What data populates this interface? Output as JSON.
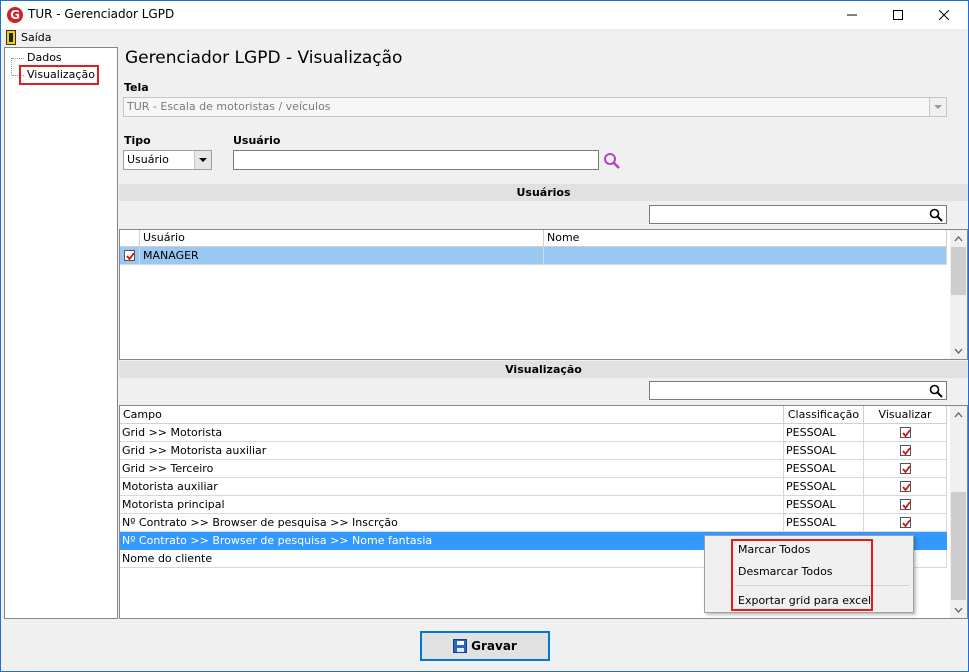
{
  "window": {
    "title": "TUR - Gerenciador LGPD",
    "icon": "app-logo-icon",
    "controls": [
      "minimize-icon",
      "maximize-icon",
      "close-icon"
    ]
  },
  "menu": {
    "exit_label": "Saída"
  },
  "tree": {
    "items": [
      {
        "label": "Dados"
      },
      {
        "label": "Visualização",
        "selected": true
      }
    ]
  },
  "main": {
    "heading": "Gerenciador LGPD - Visualização",
    "tela_label": "Tela",
    "tela_value": "TUR - Escala de motoristas / veículos",
    "tipo_label": "Tipo",
    "tipo_value": "Usuário",
    "usuario_label": "Usuário",
    "usuario_value": ""
  },
  "users_section": {
    "title": "Usuários",
    "search_value": "",
    "columns": [
      "Usuário",
      "Nome"
    ],
    "rows": [
      {
        "checked": true,
        "usuario": "MANAGER",
        "nome": ""
      }
    ]
  },
  "view_section": {
    "title": "Visualização",
    "search_value": "",
    "columns": [
      "Campo",
      "Classificação",
      "Visualizar"
    ],
    "rows": [
      {
        "campo": "Grid >> Motorista",
        "classificacao": "PESSOAL",
        "visualizar": true
      },
      {
        "campo": "Grid >> Motorista auxiliar",
        "classificacao": "PESSOAL",
        "visualizar": true
      },
      {
        "campo": "Grid >> Terceiro",
        "classificacao": "PESSOAL",
        "visualizar": true
      },
      {
        "campo": "Motorista auxiliar",
        "classificacao": "PESSOAL",
        "visualizar": true
      },
      {
        "campo": "Motorista principal",
        "classificacao": "PESSOAL",
        "visualizar": true
      },
      {
        "campo": "Nº Contrato >> Browser de pesquisa >> Inscrção",
        "classificacao": "PESSOAL",
        "visualizar": true
      },
      {
        "campo": "Nº Contrato >> Browser de pesquisa >> Nome fantasia",
        "classificacao": "",
        "visualizar": null,
        "selected": true
      },
      {
        "campo": "Nome do cliente",
        "classificacao": "",
        "visualizar": null
      }
    ]
  },
  "context_menu": {
    "items": [
      "Marcar Todos",
      "Desmarcar Todos",
      "Exportar grid para excel"
    ]
  },
  "footer": {
    "save_label": "Gravar",
    "save_icon": "floppy-disk-icon"
  },
  "colors": {
    "selection": "#3399ff",
    "selection_light": "#99c9f3",
    "highlight": "#e21c1c",
    "check": "#d01515"
  }
}
